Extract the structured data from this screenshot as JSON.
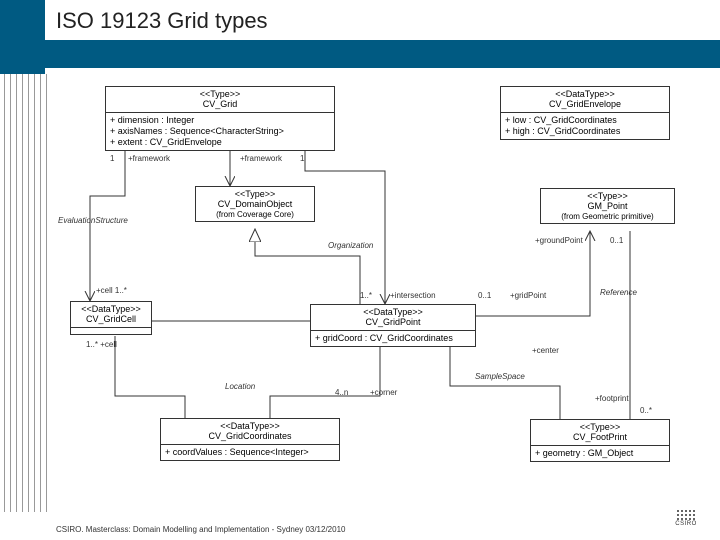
{
  "slide": {
    "title": "ISO 19123 Grid types",
    "footer": "CSIRO.  Masterclass: Domain Modelling and Implementation - Sydney 03/12/2010",
    "logo_text": "CSIRO"
  },
  "boxes": {
    "cv_grid": {
      "stereo": "<<Type>>",
      "name": "CV_Grid",
      "attrs": [
        "+ dimension : Integer",
        "+ axisNames : Sequence<CharacterString>",
        "+ extent : CV_GridEnvelope"
      ]
    },
    "cv_grid_envelope": {
      "stereo": "<<DataType>>",
      "name": "CV_GridEnvelope",
      "attrs": [
        "+ low : CV_GridCoordinates",
        "+ high : CV_GridCoordinates"
      ]
    },
    "cv_domain_object": {
      "stereo": "<<Type>>",
      "name": "CV_DomainObject",
      "origin": "(from Coverage Core)"
    },
    "gm_point": {
      "stereo": "<<Type>>",
      "name": "GM_Point",
      "origin": "(from Geometric primitive)"
    },
    "cv_grid_cell": {
      "stereo": "<<DataType>>",
      "name": "CV_GridCell"
    },
    "cv_grid_point": {
      "stereo": "<<DataType>>",
      "name": "CV_GridPoint",
      "attrs": [
        "+ gridCoord : CV_GridCoordinates"
      ]
    },
    "cv_grid_coordinates": {
      "stereo": "<<DataType>>",
      "name": "CV_GridCoordinates",
      "attrs": [
        "+ coordValues : Sequence<Integer>"
      ]
    },
    "cv_footprint": {
      "stereo": "<<Type>>",
      "name": "CV_FootPrint",
      "attrs": [
        "+ geometry : GM_Object"
      ]
    }
  },
  "labels": {
    "evaluation_structure": "EvaluationStructure",
    "organization": "Organization",
    "reference": "Reference",
    "location": "Location",
    "sample_space": "SampleSpace",
    "framework_n": "1",
    "framework_role": "+framework",
    "framework_n2": "1",
    "framework_role2": "+framework",
    "cell_n": "+cell   1..*",
    "cell_n2": "1..*   +cell",
    "intersection_n": "1..*",
    "intersection_role": "+intersection",
    "grid_point_n": "0..1",
    "grid_point_role": "+gridPoint",
    "ground_point_role": "+groundPoint",
    "ground_point_n": "0..1",
    "corner_n": "4..n",
    "corner_role": "+corner",
    "center_role": "+center",
    "footprint_role": "+footprint",
    "footprint_n": "0..*"
  }
}
